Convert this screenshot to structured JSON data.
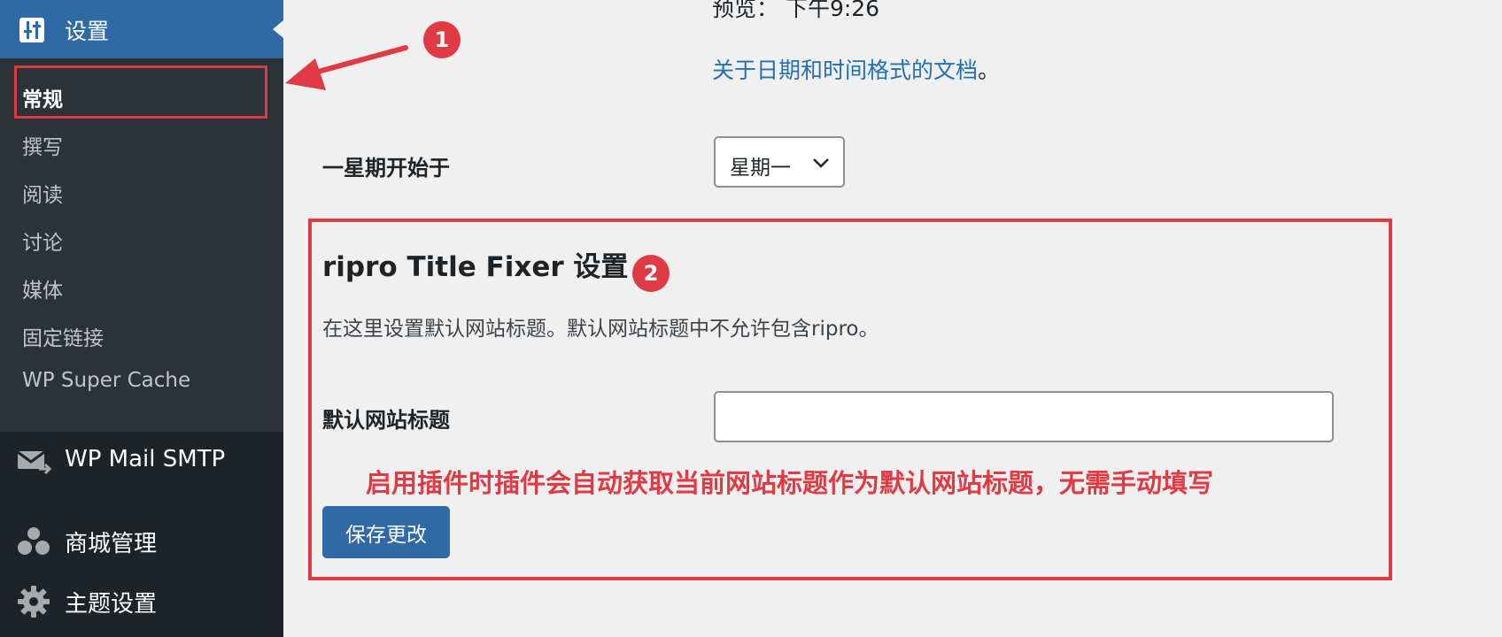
{
  "sidebar": {
    "header": {
      "label": "设置",
      "icon": "settings-sliders-icon"
    },
    "submenu": [
      {
        "label": "常规",
        "current": true
      },
      {
        "label": "撰写"
      },
      {
        "label": "阅读"
      },
      {
        "label": "讨论"
      },
      {
        "label": "媒体"
      },
      {
        "label": "固定链接"
      },
      {
        "label": "WP Super Cache"
      }
    ],
    "items": [
      {
        "label": "WP Mail SMTP",
        "icon": "mail-icon"
      },
      {
        "label": "商城管理",
        "icon": "users-icon"
      },
      {
        "label": "主题设置",
        "icon": "gear-icon"
      }
    ]
  },
  "main": {
    "preview_text": "预览： 下午9:26",
    "docs_link": "关于日期和时间格式的文档",
    "docs_suffix": "。",
    "week_start": {
      "label": "一星期开始于",
      "value": "星期一"
    },
    "plugin": {
      "title": "ripro Title Fixer 设置",
      "description": "在这里设置默认网站标题。默认网站标题中不允许包含ripro。",
      "field_label": "默认网站标题",
      "field_value": "",
      "note": "启用插件时插件会自动获取当前网站标题作为默认网站标题，无需手动填写",
      "save_label": "保存更改"
    }
  },
  "annotations": {
    "badge1": "1",
    "badge2": "2"
  },
  "colors": {
    "sidebar_bg": "#1d2327",
    "submenu_bg": "#2c3338",
    "accent": "#2f6aa6",
    "annotation": "#e03a44",
    "link": "#2271b1"
  }
}
